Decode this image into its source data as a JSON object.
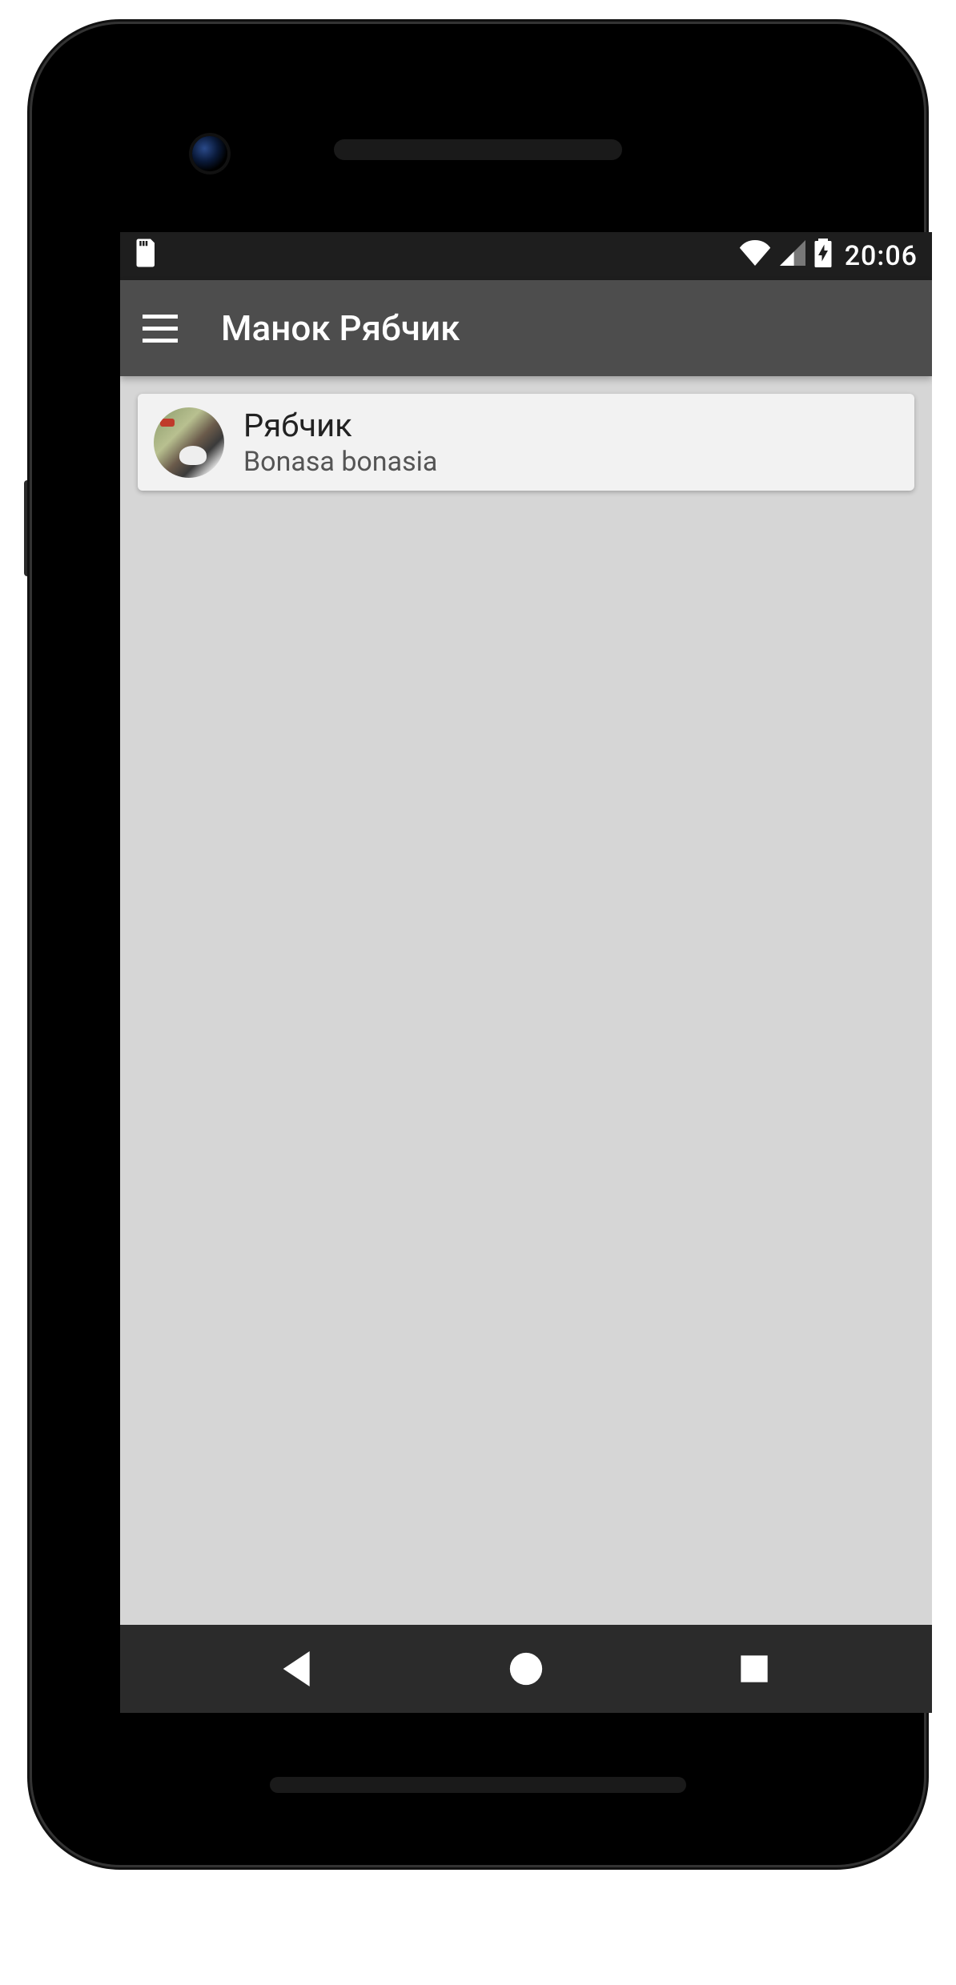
{
  "status": {
    "time": "20:06"
  },
  "appbar": {
    "title": "Манок Рябчик"
  },
  "list": {
    "items": [
      {
        "title": "Рябчик",
        "subtitle": "Bonasa bonasia"
      }
    ]
  }
}
